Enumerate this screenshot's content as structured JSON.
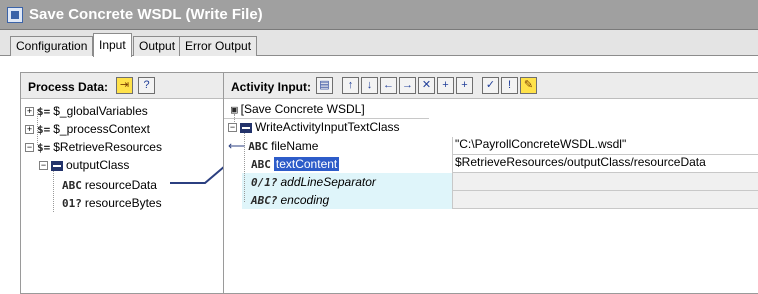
{
  "window": {
    "title": "Save Concrete WSDL (Write File)"
  },
  "tabs": [
    {
      "label": "Configuration"
    },
    {
      "label": "Input"
    },
    {
      "label": "Output"
    },
    {
      "label": "Error Output"
    }
  ],
  "active_tab": "Input",
  "process_data": {
    "title": "Process Data:",
    "tree": [
      {
        "label": "$_globalVariables",
        "icon": "dollar-equals-icon"
      },
      {
        "label": "$_processContext",
        "icon": "dollar-equals-icon"
      },
      {
        "label": "$RetrieveResources",
        "icon": "dollar-equals-icon"
      },
      {
        "label": "outputClass",
        "icon": "complex-type-icon"
      },
      {
        "label": "resourceData",
        "icon": "string-icon",
        "icon_text": "ABC"
      },
      {
        "label": "resourceBytes",
        "icon": "binary-optional-icon",
        "icon_text": "01?"
      }
    ]
  },
  "activity_input": {
    "title": "Activity Input:",
    "root": {
      "label": "[Save Concrete WSDL]"
    },
    "schema": {
      "label": "WriteActivityInputTextClass"
    },
    "fields": [
      {
        "name": "fileName",
        "icon_text": "ABC",
        "value": "\"C:\\PayrollConcreteWSDL.wsdl\"",
        "optional": false,
        "selected": false
      },
      {
        "name": "textContent",
        "icon_text": "ABC",
        "value": "$RetrieveResources/outputClass/resourceData",
        "optional": false,
        "selected": true
      },
      {
        "name": "addLineSeparator",
        "icon_text": "0/1?",
        "value": "",
        "optional": true,
        "selected": false
      },
      {
        "name": "encoding",
        "icon_text": "ABC?",
        "value": "",
        "optional": true,
        "selected": false
      }
    ]
  },
  "colors": {
    "selection": "#2d5cc9",
    "mapping_line": "#2b3f80",
    "optional_highlight": "#dff5fa"
  }
}
